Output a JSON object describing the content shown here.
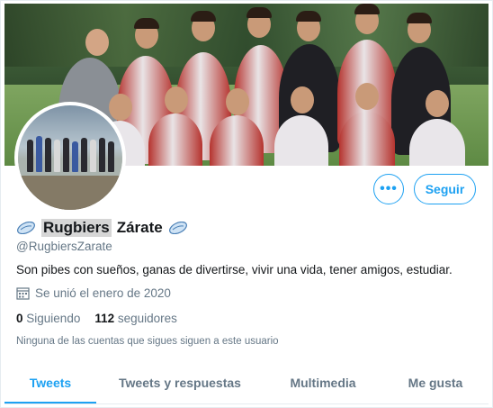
{
  "profile": {
    "name_highlight": "Rugbiers",
    "name_rest": "Zárate",
    "handle": "@RugbiersZarate",
    "bio": "Son pibes con sueños, ganas de divertirse, vivir una vida, tener amigos, estudiar.",
    "joined": "Se unió el enero de 2020",
    "following_count": "0",
    "following_label": "Siguiendo",
    "followers_count": "112",
    "followers_label": "seguidores",
    "followers_note": "Ninguna de las cuentas que sigues siguen a este usuario"
  },
  "actions": {
    "more_label": "•••",
    "follow_label": "Seguir"
  },
  "tabs": [
    {
      "label": "Tweets",
      "active": true
    },
    {
      "label": "Tweets y respuestas",
      "active": false
    },
    {
      "label": "Multimedia",
      "active": false
    },
    {
      "label": "Me gusta",
      "active": false
    }
  ],
  "colors": {
    "accent": "#1da1f2",
    "muted": "#657786",
    "text": "#14171a"
  },
  "icons": {
    "name_left": "rugby-ball-icon",
    "name_right": "rugby-ball-icon",
    "joined": "calendar-icon"
  }
}
